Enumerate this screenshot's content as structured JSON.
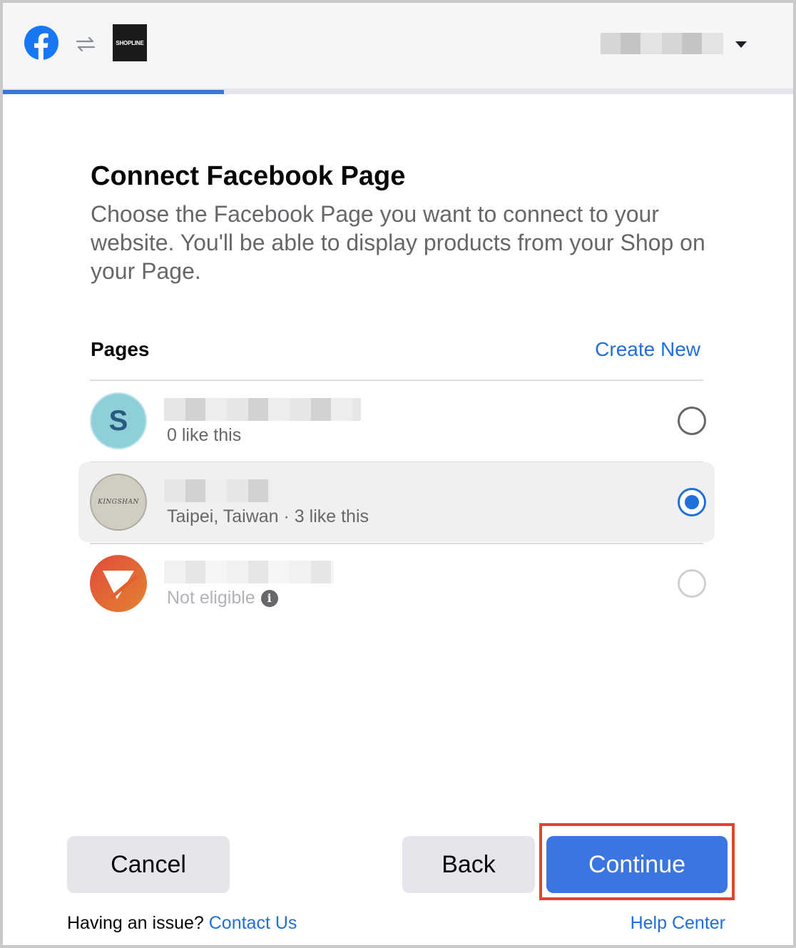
{
  "header": {
    "shop_logo_text": "SHOPLINE",
    "progress_percent": 28
  },
  "main": {
    "title": "Connect Facebook Page",
    "subtitle": "Choose the Facebook Page you want to connect to your website. You'll be able to display products from your Shop on your Page.",
    "pages_label": "Pages",
    "create_new": "Create New",
    "pages": [
      {
        "avatar_letter": "S",
        "meta": "0 like this",
        "selected": false,
        "eligible": true
      },
      {
        "avatar_text": "KINGSHAN",
        "meta": "Taipei, Taiwan · 3 like this",
        "selected": true,
        "eligible": true
      },
      {
        "meta": "Not eligible",
        "selected": false,
        "eligible": false
      }
    ]
  },
  "footer": {
    "cancel": "Cancel",
    "back": "Back",
    "continue": "Continue",
    "issue_prefix": "Having an issue? ",
    "contact_us": "Contact Us",
    "help_center": "Help Center"
  },
  "colors": {
    "accent": "#216fdb",
    "continue_bg": "#3a75e0",
    "highlight": "#e2452f"
  }
}
